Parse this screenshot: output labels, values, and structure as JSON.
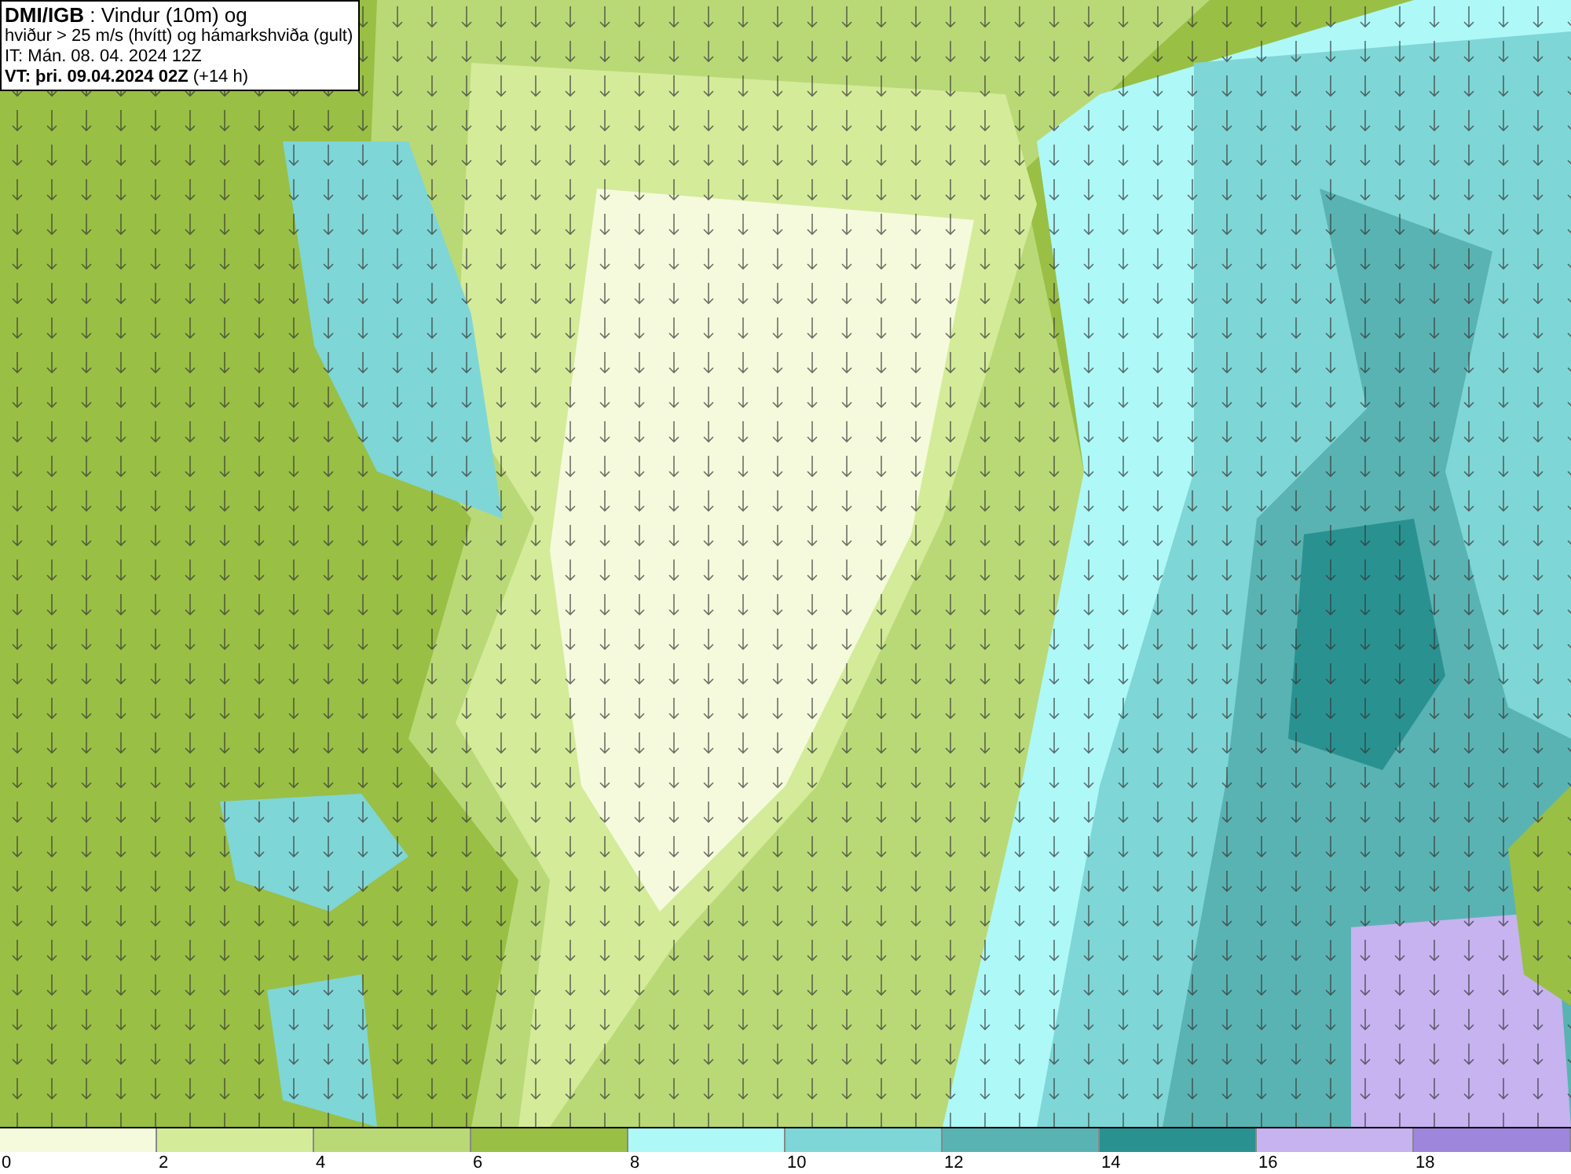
{
  "title_box": {
    "lines": [
      "**DMI/IGB** : Vindur (10m) og",
      "hviður > 25 m/s (hvítt) og hámarkshviða (gult)",
      "IT: Mán. 08. 04. 2024 12Z",
      "**VT: þri. 09.04.2024 02Z** (+14 h)"
    ]
  },
  "legend": {
    "segments": [
      {
        "color": "#f5fadc"
      },
      {
        "color": "#d4eb9a"
      },
      {
        "color": "#b9d977"
      },
      {
        "color": "#99bf45"
      },
      {
        "color": "#aef8f8"
      },
      {
        "color": "#7fd6d6"
      },
      {
        "color": "#5ab3b3"
      },
      {
        "color": "#2a9191"
      },
      {
        "color": "#c6b3f0"
      },
      {
        "color": "#9d86dc"
      }
    ],
    "labels": [
      "0",
      "2",
      "4",
      "6",
      "8",
      "10",
      "12",
      "14",
      "16",
      "18"
    ]
  }
}
